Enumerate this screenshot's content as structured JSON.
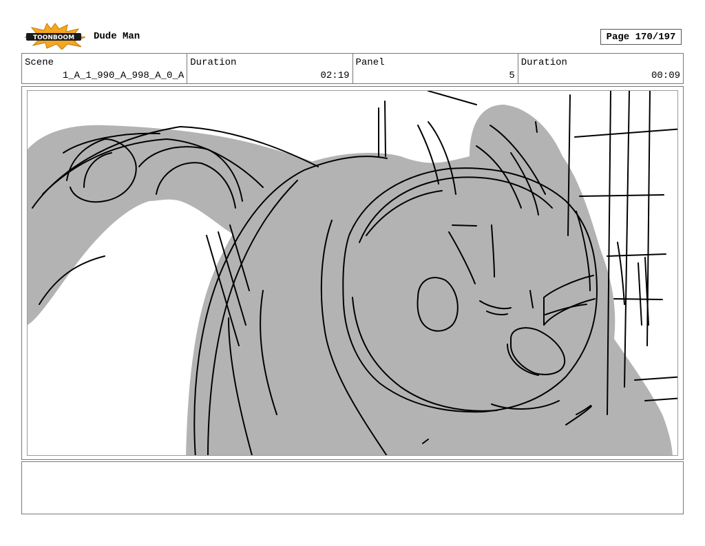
{
  "header": {
    "logo_text": "TOONBOOM",
    "project_title": "Dude Man",
    "page_label": "Page 170/197"
  },
  "info": {
    "scene_label": "Scene",
    "scene_value": "1_A_1_990_A_998_A_0_A",
    "scene_duration_label": "Duration",
    "scene_duration_value": "02:19",
    "panel_label": "Panel",
    "panel_value": "5",
    "panel_duration_label": "Duration",
    "panel_duration_value": "00:09"
  },
  "colors": {
    "fill_gray": "#b3b3b3",
    "ink": "#000000",
    "logo_orange": "#f5a623"
  },
  "notes": ""
}
